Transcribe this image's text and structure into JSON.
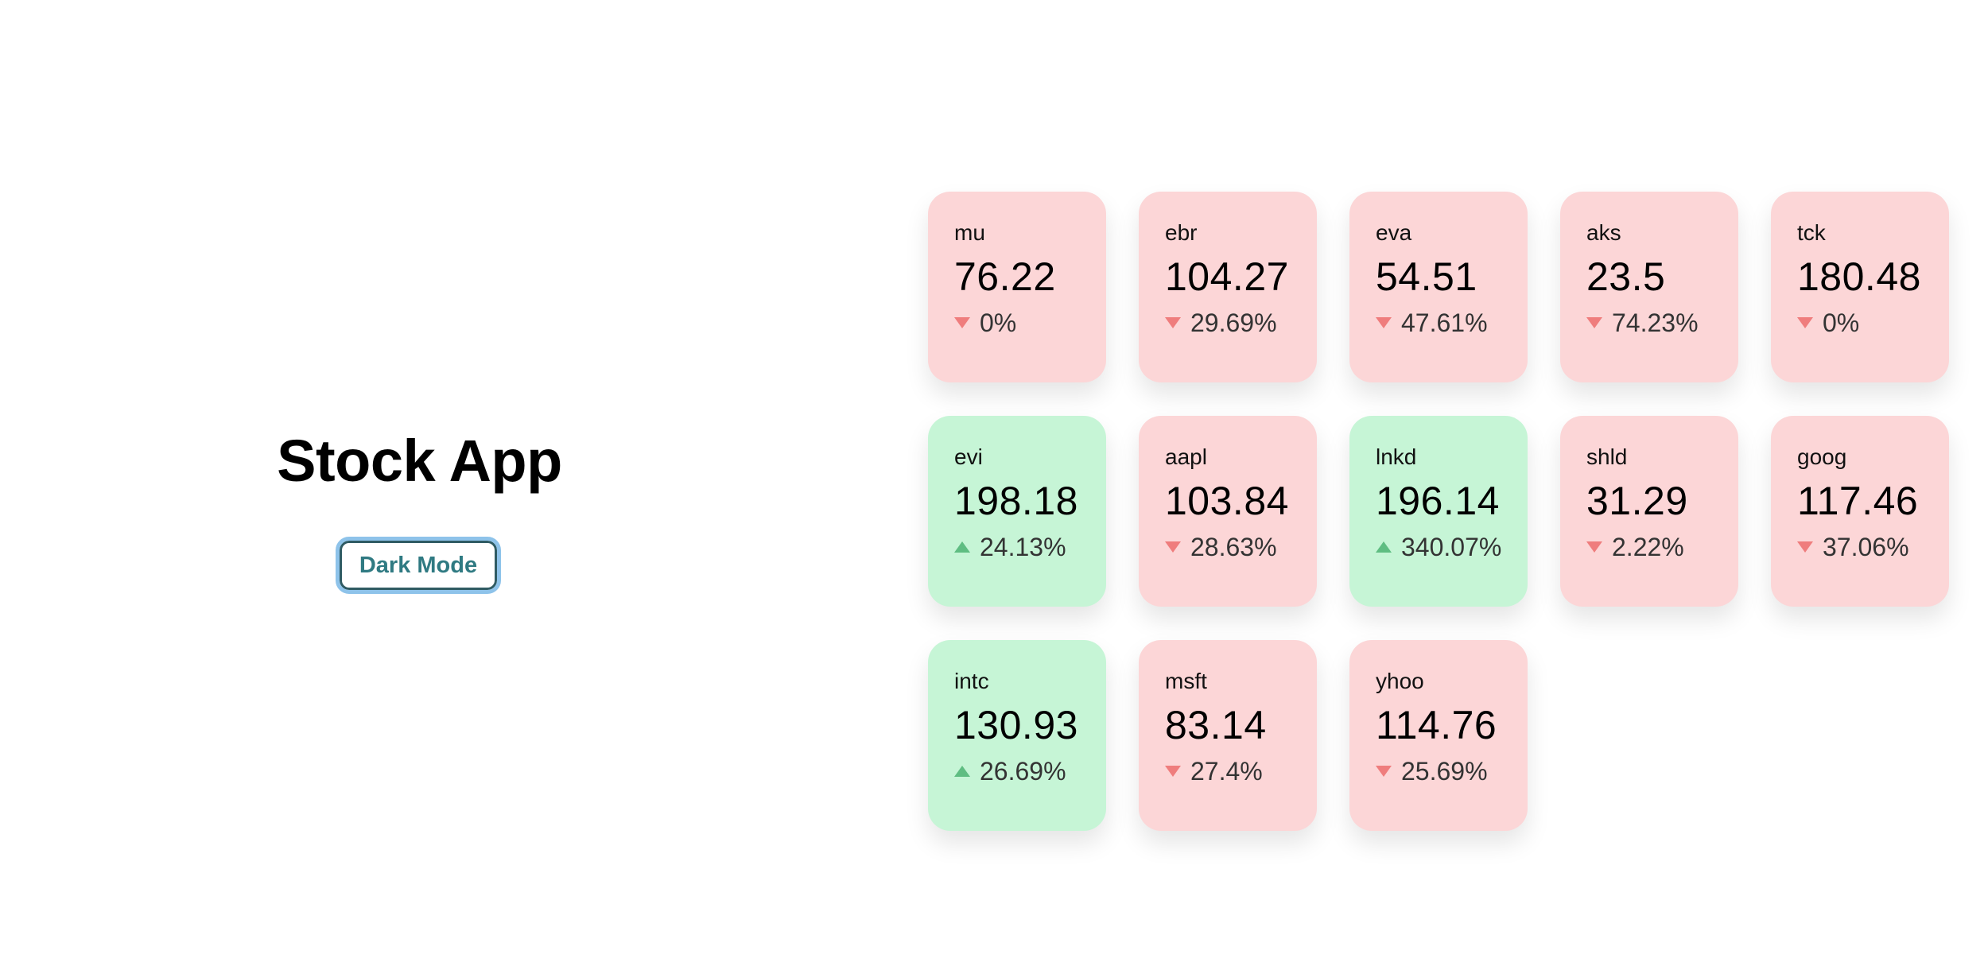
{
  "app": {
    "title": "Stock App",
    "dark_mode_label": "Dark Mode"
  },
  "colors": {
    "down_card": "#fcd6d7",
    "up_card": "#c6f5d6",
    "down_arrow": "#ef7d7d",
    "up_arrow": "#5fbd82",
    "button_text": "#2f7a82",
    "button_focus_ring": "#8ec3ea"
  },
  "stocks": [
    {
      "ticker": "mu",
      "price": "76.22",
      "change": "0%",
      "direction": "down",
      "icon": "triangle-down-icon"
    },
    {
      "ticker": "ebr",
      "price": "104.27",
      "change": "29.69%",
      "direction": "down",
      "icon": "triangle-down-icon"
    },
    {
      "ticker": "eva",
      "price": "54.51",
      "change": "47.61%",
      "direction": "down",
      "icon": "triangle-down-icon"
    },
    {
      "ticker": "aks",
      "price": "23.5",
      "change": "74.23%",
      "direction": "down",
      "icon": "triangle-down-icon"
    },
    {
      "ticker": "tck",
      "price": "180.48",
      "change": "0%",
      "direction": "down",
      "icon": "triangle-down-icon"
    },
    {
      "ticker": "evi",
      "price": "198.18",
      "change": "24.13%",
      "direction": "up",
      "icon": "triangle-up-icon"
    },
    {
      "ticker": "aapl",
      "price": "103.84",
      "change": "28.63%",
      "direction": "down",
      "icon": "triangle-down-icon"
    },
    {
      "ticker": "lnkd",
      "price": "196.14",
      "change": "340.07%",
      "direction": "up",
      "icon": "triangle-up-icon"
    },
    {
      "ticker": "shld",
      "price": "31.29",
      "change": "2.22%",
      "direction": "down",
      "icon": "triangle-down-icon"
    },
    {
      "ticker": "goog",
      "price": "117.46",
      "change": "37.06%",
      "direction": "down",
      "icon": "triangle-down-icon"
    },
    {
      "ticker": "intc",
      "price": "130.93",
      "change": "26.69%",
      "direction": "up",
      "icon": "triangle-up-icon"
    },
    {
      "ticker": "msft",
      "price": "83.14",
      "change": "27.4%",
      "direction": "down",
      "icon": "triangle-down-icon"
    },
    {
      "ticker": "yhoo",
      "price": "114.76",
      "change": "25.69%",
      "direction": "down",
      "icon": "triangle-down-icon"
    }
  ]
}
